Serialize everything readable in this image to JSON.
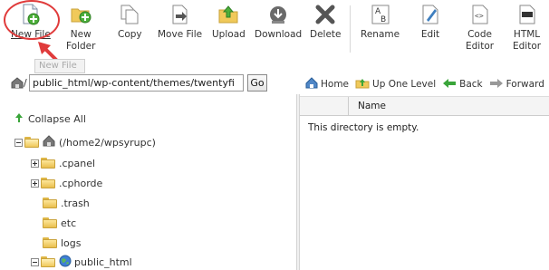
{
  "toolbar": {
    "buttons": [
      {
        "label": "New File"
      },
      {
        "label": "New\nFolder"
      },
      {
        "label": "Copy"
      },
      {
        "label": "Move File"
      },
      {
        "label": "Upload"
      },
      {
        "label": "Download"
      },
      {
        "label": "Delete"
      },
      {
        "label": "Rename"
      },
      {
        "label": "Edit"
      },
      {
        "label": "Code\nEditor"
      },
      {
        "label": "HTML\nEditor"
      }
    ],
    "tooltip": "New File"
  },
  "path": {
    "value": "public_html/wp-content/themes/twentyfi",
    "go_label": "Go",
    "root_prefix": "/"
  },
  "nav": {
    "home": "Home",
    "up": "Up One Level",
    "back": "Back",
    "forward": "Forward"
  },
  "table": {
    "col_name": "Name",
    "empty_message": "This directory is empty."
  },
  "tree": {
    "collapse_all": "Collapse All",
    "root": "(/home2/wpsyrupc)",
    "items": [
      {
        "label": ".cpanel"
      },
      {
        "label": ".cphorde"
      },
      {
        "label": ".trash"
      },
      {
        "label": "etc"
      },
      {
        "label": "logs"
      },
      {
        "label": "public_html"
      }
    ]
  },
  "colors": {
    "highlight": "#e03b3b",
    "folder": "#f0c95a",
    "green_arrow": "#3aa53a"
  }
}
